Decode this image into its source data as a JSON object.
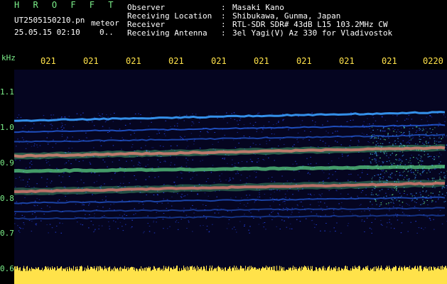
{
  "header": {
    "title": "H R O F F T",
    "filename": "UT2505150210.pn",
    "meteor_label": "meteor",
    "datetime": "25.05.15 02:10",
    "flag": "0..",
    "meta": [
      {
        "label": "Observer",
        "value": "Masaki Kano"
      },
      {
        "label": "Receiving Location",
        "value": "Shibukawa, Gunma, Japan"
      },
      {
        "label": "Receiver",
        "value": "RTL-SDR SDR# 43dB L15 103.2MHz CW"
      },
      {
        "label": "Receiving Antenna",
        "value": "3el Yagi(V) Az 330 for Vladivostok"
      }
    ],
    "colon": ":"
  },
  "y_axis": {
    "unit": "kHz",
    "ticks": [
      "1.1",
      "1.0",
      "0.9",
      "0.8",
      "0.7",
      "0.6"
    ]
  },
  "x_axis": {
    "ticks": [
      "021",
      "021",
      "021",
      "021",
      "021",
      "021",
      "021",
      "021",
      "021",
      "0220"
    ]
  },
  "colors": {
    "background": "#000000",
    "label_green": "#7cf08a",
    "label_yellow": "#ffe24a",
    "trace_red": "#ff3a5a",
    "trace_green": "#6cff9a",
    "noise_blue": "#2a4cff"
  }
}
